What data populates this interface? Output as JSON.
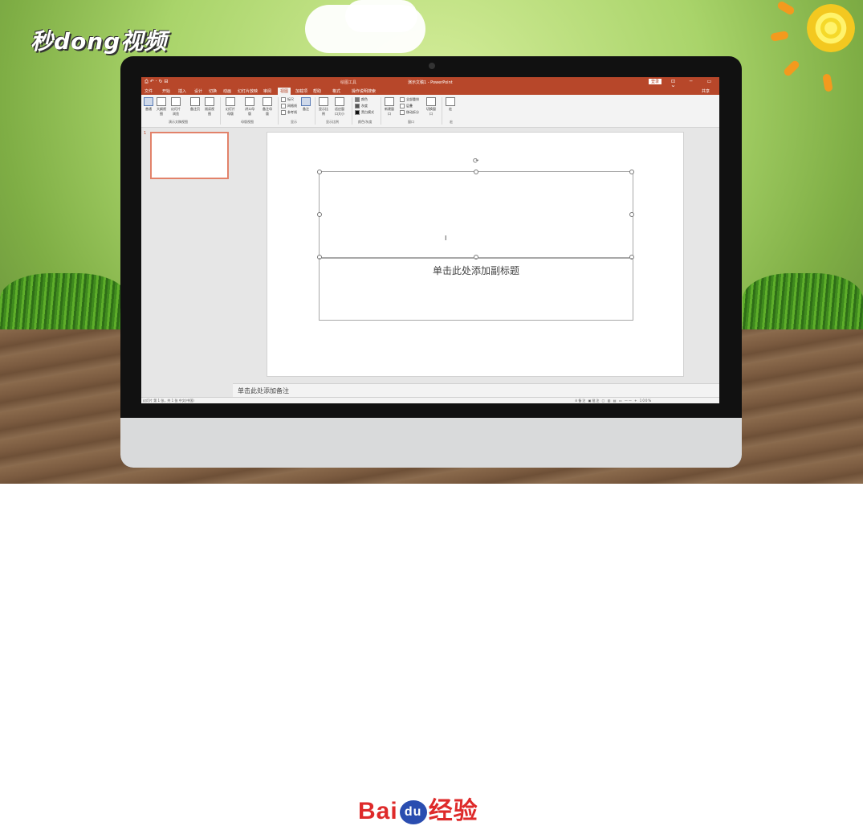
{
  "watermark": {
    "brand_text": "秒dong视频"
  },
  "footer_brand": {
    "text_a": "Bai",
    "text_du": "du",
    "text_b": "经验"
  },
  "app": {
    "quick_access": "⎙ ↶ · ↻ ⊟",
    "tools_context": "绘图工具",
    "title": "演示文稿1 - PowerPoint",
    "login": "登录",
    "window_controls": "⊡ ─ ▭ ✕",
    "share": "共享"
  },
  "tabs": [
    {
      "label": "文件"
    },
    {
      "label": "开始"
    },
    {
      "label": "插入"
    },
    {
      "label": "设计"
    },
    {
      "label": "切换"
    },
    {
      "label": "动画"
    },
    {
      "label": "幻灯片放映"
    },
    {
      "label": "审阅"
    },
    {
      "label": "视图"
    },
    {
      "label": "加载项"
    },
    {
      "label": "帮助"
    },
    {
      "label": "格式"
    },
    {
      "label": "操作说明搜索"
    }
  ],
  "ribbon": {
    "views": [
      "普通",
      "大纲视图",
      "幻灯片浏览",
      "备注页",
      "阅读视图"
    ],
    "masters": [
      "幻灯片母版",
      "讲义母版",
      "备注母版"
    ],
    "show": [
      "标尺",
      "网格线",
      "参考线"
    ],
    "notes_btn": "备注",
    "zoom": [
      "显示比例",
      "适应窗口大小"
    ],
    "color": [
      "颜色",
      "灰度",
      "黑白模式"
    ],
    "window": [
      "新建窗口",
      "全部重排",
      "层叠",
      "移动拆分",
      "切换窗口"
    ],
    "macro": "宏",
    "group_labels": [
      "演示文稿视图",
      "母版视图",
      "显示",
      "显示比例",
      "颜色/灰度",
      "窗口",
      "宏"
    ]
  },
  "slides": {
    "number": "1"
  },
  "slide": {
    "subtitle_placeholder": "单击此处添加副标题",
    "cursor": "I"
  },
  "notes": {
    "placeholder": "单击此处添加备注"
  },
  "status": {
    "left": "幻灯片 第 1 张，共 1 张   中文(中国)",
    "right": "≜备注  ▣批注  ▢ ▥ ▤ ▭  —— + 100%"
  }
}
